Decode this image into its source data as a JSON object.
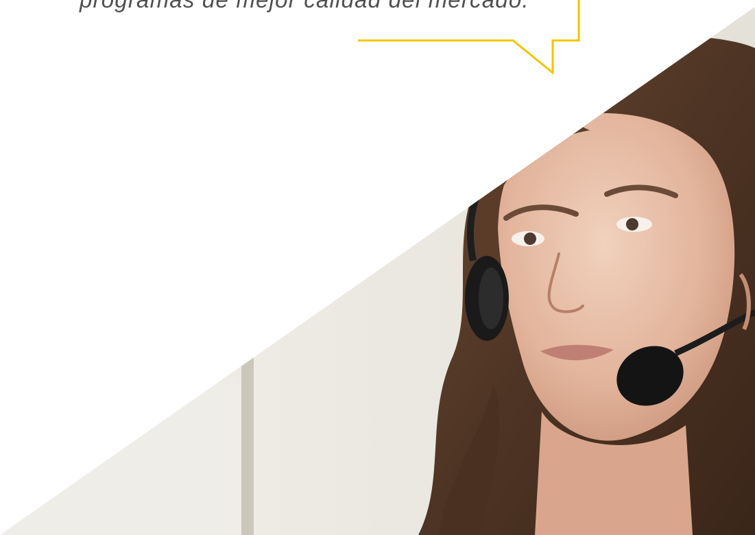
{
  "quote": {
    "text": "programas de mejor calidad del mercado."
  },
  "colors": {
    "accent": "#f2c400",
    "quote_text": "#4f4f4f",
    "background": "#ffffff"
  },
  "image": {
    "subject": "photo-woman-with-headset"
  }
}
